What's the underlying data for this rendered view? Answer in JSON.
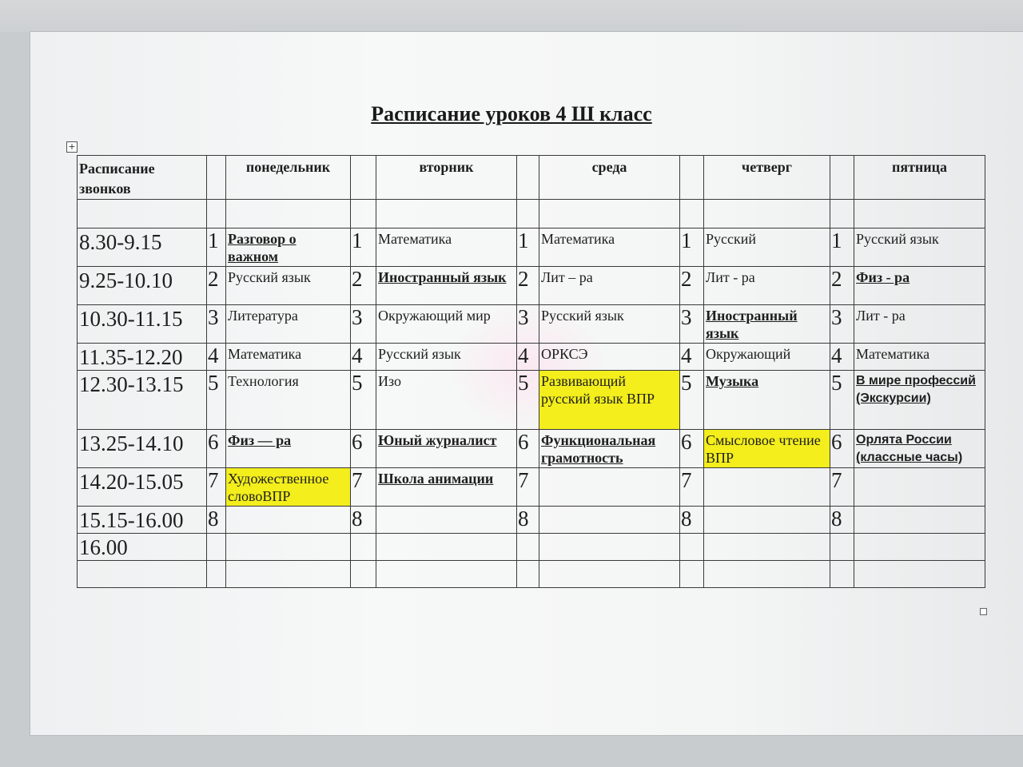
{
  "title": "Расписание уроков 4 Ш класс",
  "headers": {
    "bells": "Расписание звонков",
    "days": [
      "понедельник",
      "вторник",
      "среда",
      "четверг",
      "пятница"
    ]
  },
  "rows": [
    {
      "time": "8.30-9.15",
      "n": "1",
      "cells": [
        {
          "text": "Разговор о важном",
          "bold": true
        },
        {
          "text": "Математика"
        },
        {
          "text": "Математика"
        },
        {
          "text": "Русский"
        },
        {
          "text": "Русский язык"
        }
      ]
    },
    {
      "time": "9.25-10.10",
      "n": "2",
      "cells": [
        {
          "text": "Русский язык"
        },
        {
          "text": "Иностранный язык",
          "bold": true
        },
        {
          "text": "Лит – ра"
        },
        {
          "text": "Лит - ра"
        },
        {
          "text": "Физ - ра",
          "bold": true
        }
      ]
    },
    {
      "time": "10.30-11.15",
      "n": "3",
      "cells": [
        {
          "text": "Литература"
        },
        {
          "text": "Окружающий мир"
        },
        {
          "text": "Русский язык"
        },
        {
          "text": "Иностранный язык",
          "bold": true
        },
        {
          "text": "Лит - ра"
        }
      ]
    },
    {
      "time": "11.35-12.20",
      "n": "4",
      "cells": [
        {
          "text": "Математика"
        },
        {
          "text": "Русский язык"
        },
        {
          "text": "ОРКСЭ"
        },
        {
          "text": "Окружающий"
        },
        {
          "text": "Математика"
        }
      ]
    },
    {
      "time": "12.30-13.15",
      "n": "5",
      "cells": [
        {
          "text": "Технология"
        },
        {
          "text": "Изо"
        },
        {
          "text": "Развивающий русский язык ВПР",
          "highlight": true
        },
        {
          "text": "Музыка",
          "bold": true
        },
        {
          "text": "В мире профессий (Экскурсии)",
          "bold": true
        }
      ]
    },
    {
      "time": "13.25-14.10",
      "n": "6",
      "cells": [
        {
          "text": "Физ — ра",
          "bold": true
        },
        {
          "text": "Юный журналист",
          "bold": true
        },
        {
          "text": "Функциональная грамотность",
          "bold": true
        },
        {
          "text": "Смысловое чтение ВПР",
          "highlight": true
        },
        {
          "text": "Орлята России (классные часы)",
          "bold": true
        }
      ]
    },
    {
      "time": "14.20-15.05",
      "n": "7",
      "cells": [
        {
          "text": "Художественное словоВПР",
          "highlight": true
        },
        {
          "text": "Школа анимации",
          "bold": true
        },
        {
          "text": ""
        },
        {
          "text": ""
        },
        {
          "text": ""
        }
      ]
    },
    {
      "time": "15.15-16.00",
      "n": "8",
      "cells": [
        {
          "text": ""
        },
        {
          "text": ""
        },
        {
          "text": ""
        },
        {
          "text": ""
        },
        {
          "text": ""
        }
      ]
    },
    {
      "time": "16.00",
      "n": "",
      "cells": [
        {
          "text": ""
        },
        {
          "text": ""
        },
        {
          "text": ""
        },
        {
          "text": ""
        },
        {
          "text": ""
        }
      ]
    }
  ],
  "colors": {
    "highlight": "#f3ee1c",
    "grid": "#3a3a3a",
    "paper": "#f4f5f5"
  }
}
